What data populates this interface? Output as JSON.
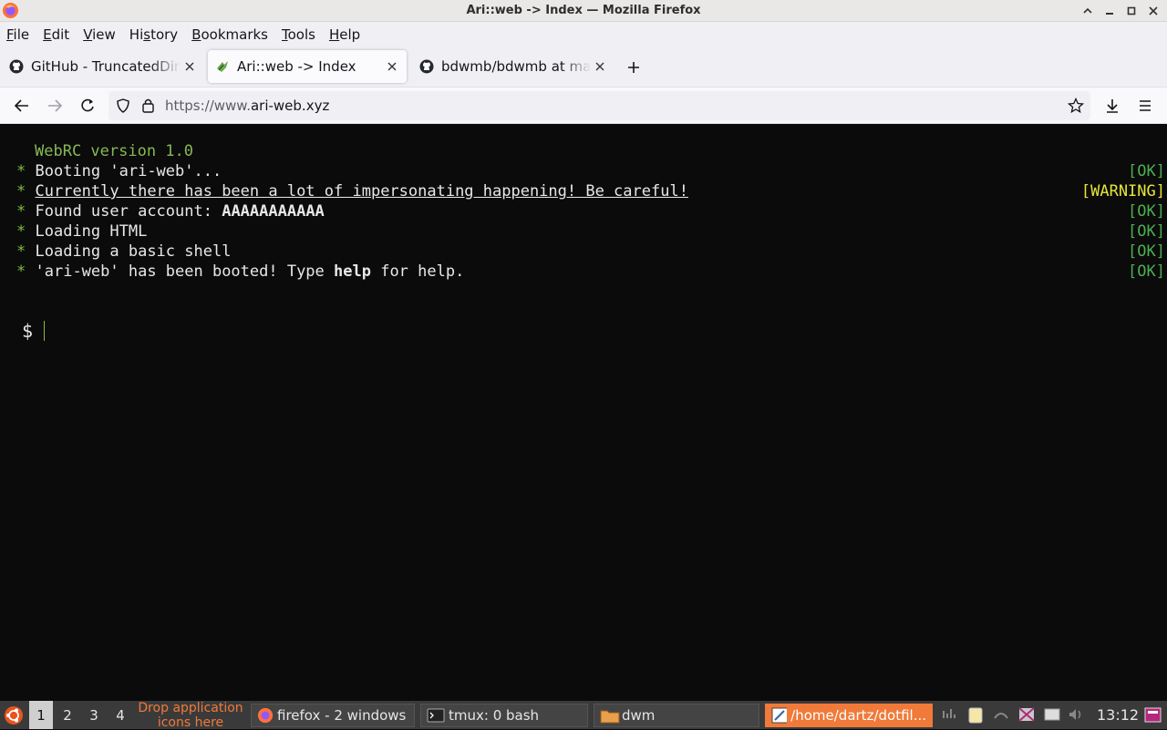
{
  "window": {
    "title": "Ari::web -> Index — Mozilla Firefox"
  },
  "menu": [
    {
      "label": "File",
      "key": "F",
      "rest": "ile"
    },
    {
      "label": "Edit",
      "key": "E",
      "rest": "dit"
    },
    {
      "label": "View",
      "key": "V",
      "rest": "iew"
    },
    {
      "label": "History",
      "key": "s",
      "pre": "Hi",
      "rest": "tory"
    },
    {
      "label": "Bookmarks",
      "key": "B",
      "rest": "ookmarks"
    },
    {
      "label": "Tools",
      "key": "T",
      "rest": "ools"
    },
    {
      "label": "Help",
      "key": "H",
      "rest": "elp"
    }
  ],
  "tabs": [
    {
      "label": "GitHub - TruncatedDinosaur",
      "icon": "github-icon",
      "active": false
    },
    {
      "label": "Ari::web -> Index",
      "icon": "ariweb-icon",
      "active": true
    },
    {
      "label": "bdwmb/bdwmb at main",
      "icon": "github-icon",
      "active": false
    }
  ],
  "url": {
    "prefix": "https://www.",
    "host": "ari-web.xyz"
  },
  "terminal": {
    "header": "WebRC version 1.0",
    "lines": [
      {
        "star": "*",
        "text": "Booting 'ari-web'...",
        "status": "[OK]",
        "level": "ok"
      },
      {
        "star": "*",
        "text": "Currently there has been a lot of impersonating happening! Be careful!",
        "status": "[WARNING]",
        "level": "warn"
      },
      {
        "star": "*",
        "pre": "Found user account: ",
        "bold": "AAAAAAAAAAA",
        "post": "",
        "status": "[OK]",
        "level": "ok"
      },
      {
        "star": "*",
        "text": "Loading HTML",
        "status": "[OK]",
        "level": "ok"
      },
      {
        "star": "*",
        "text": "Loading a basic shell",
        "status": "[OK]",
        "level": "ok"
      },
      {
        "star": "*",
        "pre": "'ari-web' has been booted! Type ",
        "bold": "help",
        "post": " for help.",
        "status": "[OK]",
        "level": "ok"
      }
    ],
    "prompt": "$"
  },
  "taskbar": {
    "workspaces": [
      "1",
      "2",
      "3",
      "4"
    ],
    "drop_hint": "Drop application icons here",
    "drop_line1": "Drop application",
    "drop_line2": "icons here",
    "tasks": [
      {
        "label": "firefox - 2 windows",
        "icon": "firefox-icon"
      },
      {
        "label": "tmux: 0 bash",
        "icon": "terminal-icon"
      },
      {
        "label": "dwm",
        "icon": "folder-icon"
      },
      {
        "label": "/home/dartz/dotfil...",
        "icon": "editor-icon",
        "active": true
      }
    ],
    "clock": "13:12"
  },
  "colors": {
    "ok": "#4caf50",
    "warning": "#e5e53a",
    "accent": "#f07a3a"
  }
}
